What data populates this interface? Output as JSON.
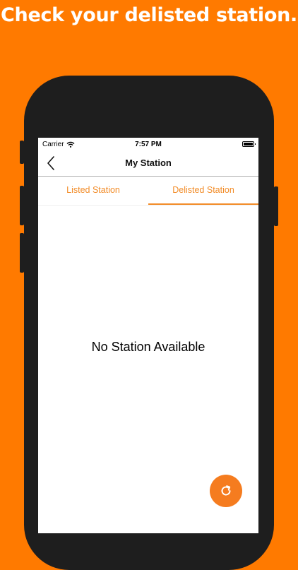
{
  "headline": "Check your delisted station.",
  "status_bar": {
    "carrier": "Carrier",
    "time": "7:57 PM",
    "wifi_icon": "wifi-icon",
    "battery_icon": "battery-icon"
  },
  "navbar": {
    "title": "My Station",
    "back_icon": "chevron-left-icon"
  },
  "tabs": [
    {
      "label": "Listed Station",
      "selected": false
    },
    {
      "label": "Delisted Station",
      "selected": true
    }
  ],
  "empty_state": {
    "message": "No Station Available"
  },
  "fab": {
    "icon": "refresh-icon"
  },
  "colors": {
    "background": "#FF7A00",
    "accent": "#F28C28",
    "phone": "#1E1E1E"
  }
}
